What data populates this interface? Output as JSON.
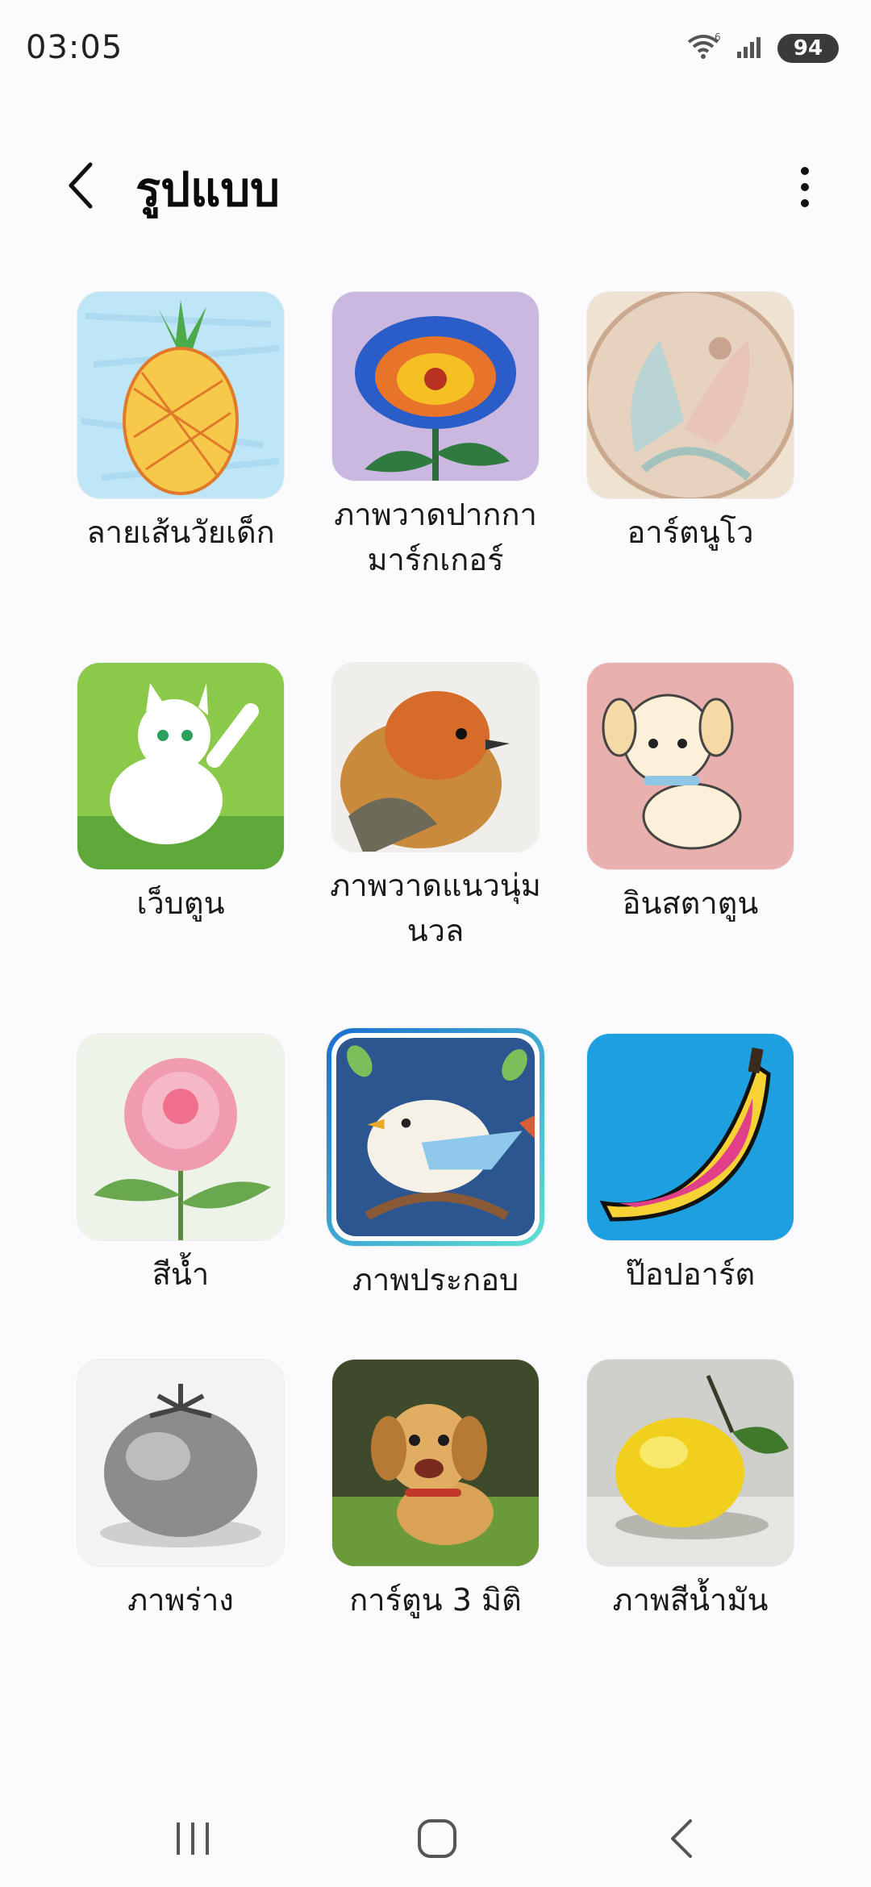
{
  "status": {
    "time": "03:05",
    "battery": "94",
    "network_badge": "6"
  },
  "header": {
    "title": "รูปแบบ"
  },
  "styles": [
    {
      "label": "ลายเส้นวัยเด็ก",
      "selected": false
    },
    {
      "label": "ภาพวาดปากกามาร์กเกอร์",
      "selected": false
    },
    {
      "label": "อาร์ตนูโว",
      "selected": false
    },
    {
      "label": "เว็บตูน",
      "selected": false
    },
    {
      "label": "ภาพวาดแนวนุ่มนวล",
      "selected": false
    },
    {
      "label": "อินสตาตูน",
      "selected": false
    },
    {
      "label": "สีน้ำ",
      "selected": false
    },
    {
      "label": "ภาพประกอบ",
      "selected": true
    },
    {
      "label": "ป๊อปอาร์ต",
      "selected": false
    },
    {
      "label": "ภาพร่าง",
      "selected": false
    },
    {
      "label": "การ์ตูน 3 มิติ",
      "selected": false
    },
    {
      "label": "ภาพสีน้ำมัน",
      "selected": false
    }
  ],
  "icons": {
    "back": "chevron-left-icon",
    "more": "more-vert-icon",
    "wifi": "wifi-icon",
    "signal": "signal-icon",
    "nav_recents": "recents-icon",
    "nav_home": "home-icon",
    "nav_back": "back-icon"
  },
  "colors": {
    "accent_selected_start": "#1a6fd1",
    "accent_selected_end": "#5fe0d4",
    "background": "#fbfbfd"
  }
}
